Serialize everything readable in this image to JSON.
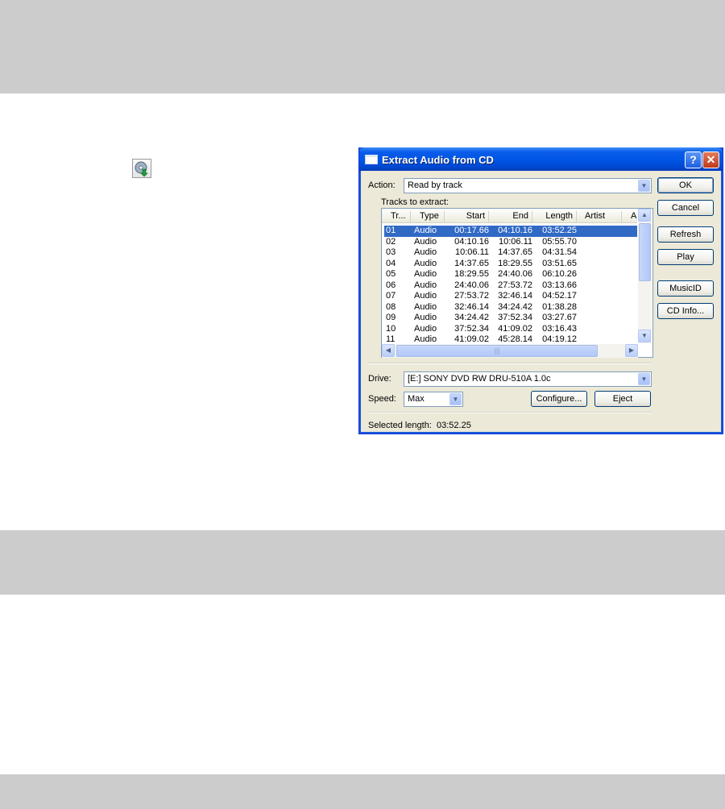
{
  "dialog": {
    "title": "Extract Audio from CD",
    "help_label": "?",
    "close_label": "✕",
    "action_label": "Action:",
    "action_value": "Read by track",
    "tracks_label": "Tracks to extract:",
    "columns": [
      "Tr...",
      "Type",
      "Start",
      "End",
      "Length",
      "Artist",
      "A"
    ],
    "tracks": [
      {
        "track": "01",
        "type": "Audio",
        "start": "00:17.66",
        "end": "04:10.16",
        "length": "03:52.25"
      },
      {
        "track": "02",
        "type": "Audio",
        "start": "04:10.16",
        "end": "10:06.11",
        "length": "05:55.70"
      },
      {
        "track": "03",
        "type": "Audio",
        "start": "10:06.11",
        "end": "14:37.65",
        "length": "04:31.54"
      },
      {
        "track": "04",
        "type": "Audio",
        "start": "14:37.65",
        "end": "18:29.55",
        "length": "03:51.65"
      },
      {
        "track": "05",
        "type": "Audio",
        "start": "18:29.55",
        "end": "24:40.06",
        "length": "06:10.26"
      },
      {
        "track": "06",
        "type": "Audio",
        "start": "24:40.06",
        "end": "27:53.72",
        "length": "03:13.66"
      },
      {
        "track": "07",
        "type": "Audio",
        "start": "27:53.72",
        "end": "32:46.14",
        "length": "04:52.17"
      },
      {
        "track": "08",
        "type": "Audio",
        "start": "32:46.14",
        "end": "34:24.42",
        "length": "01:38.28"
      },
      {
        "track": "09",
        "type": "Audio",
        "start": "34:24.42",
        "end": "37:52.34",
        "length": "03:27.67"
      },
      {
        "track": "10",
        "type": "Audio",
        "start": "37:52.34",
        "end": "41:09.02",
        "length": "03:16.43"
      },
      {
        "track": "11",
        "type": "Audio",
        "start": "41:09.02",
        "end": "45:28.14",
        "length": "04:19.12"
      }
    ],
    "selected_track": "01",
    "drive_label": "Drive:",
    "drive_value": "[E:] SONY DVD RW DRU-510A 1.0c",
    "speed_label": "Speed:",
    "speed_value": "Max",
    "configure_label": "Configure...",
    "eject_label": "Eject",
    "selected_length_label": "Selected length:",
    "selected_length_value": "03:52.25",
    "buttons": {
      "ok": "OK",
      "cancel": "Cancel",
      "refresh": "Refresh",
      "play": "Play",
      "musicid": "MusicID",
      "cdinfo": "CD Info..."
    }
  },
  "icons": {
    "toolbar": "extract-audio-cd-icon",
    "dropdown_arrow": "chevron-down-icon",
    "scroll_up": "scroll-up-icon",
    "scroll_down": "scroll-down-icon",
    "scroll_left": "scroll-left-icon",
    "scroll_right": "scroll-right-icon"
  },
  "colors": {
    "titlebar": "#0055e5",
    "selection": "#316ac5",
    "dialog_bg": "#ece9d8",
    "band_gray": "#cccccc"
  }
}
